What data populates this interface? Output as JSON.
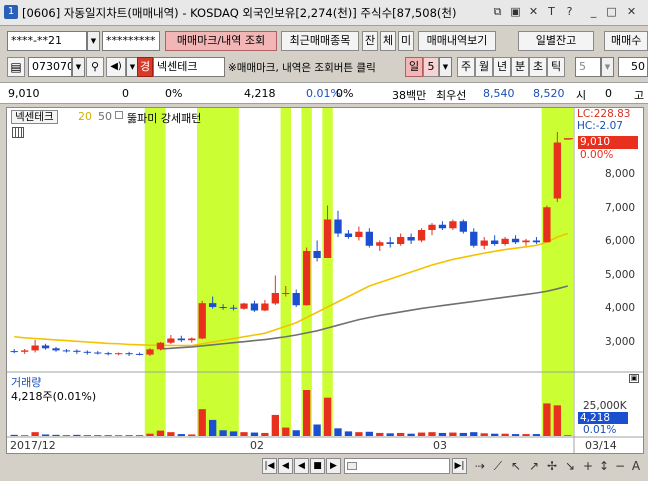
{
  "window": {
    "number_badge": "1",
    "title": "[0606] 자동일지차트(매매내역) - KOSDAQ 외국인보유[2,274(천)] 주식수[87,508(천)",
    "icons": [
      "restore-icon",
      "tile-icon",
      "pin-icon",
      "text-icon",
      "help-icon",
      "minimize-icon",
      "maximize-icon",
      "close-icon"
    ],
    "icon_glyphs": [
      "⧉",
      "▣",
      "✕",
      "T",
      "?",
      "_",
      "□",
      "✕"
    ]
  },
  "toolbar1": {
    "account": "****-**21",
    "password": "*********",
    "trade_mark_button": "매매마크/내역 조회",
    "recent_items_button": "최근매매종목",
    "balance_button": "잔",
    "filled_button": "체",
    "unfilled_button": "미",
    "trade_history_button": "매매내역보기",
    "daily_balance_button": "일별잔고",
    "trade_cut_button": "매매수"
  },
  "toolbar2": {
    "stock_code": "073070",
    "market_badge": "경",
    "stock_name": "넥센테크",
    "notice": "※매매마크, 내역은 조회버튼 클릭",
    "period_day": "일",
    "period_num": "5",
    "period_week": "주",
    "period_month": "월",
    "period_year": "년",
    "period_minute": "분",
    "period_second": "초",
    "period_tick": "틱",
    "tick_num": "5",
    "count_value": "50"
  },
  "quote": {
    "price": "9,010",
    "change": "0",
    "change_pct": "0%",
    "volume": "4,218",
    "vol_pct": "0.01%",
    "zero_pct": "0%",
    "trade_amount": "38백만",
    "best_bid_label": "최우선",
    "ask": "8,540",
    "bid": "8,520",
    "hoga_label": "시",
    "hoga_value": "0",
    "last_label": "고"
  },
  "chart": {
    "legend_name": "넥센테크",
    "ma_short": "20",
    "ma_long": "50",
    "pattern_label": "뚫파미 강세패턴",
    "lc_label": "LC:228.83",
    "hc_label": "HC:-2.07",
    "current_price_label": "9,010",
    "current_pct_label": "0.00%",
    "price_ticks": [
      "8,000",
      "7,000",
      "6,000",
      "5,000",
      "4,000",
      "3,000"
    ],
    "volume_title": "거래량",
    "volume_value": "4,218주(0.01%)",
    "volume_tick": "25,000K",
    "volume_current": "4,218",
    "volume_pct": "0.01%",
    "date_labels": [
      "2017/12",
      "02",
      "03"
    ],
    "last_date": "03/14",
    "colors": {
      "up": "#e8301f",
      "down": "#1a4fd0",
      "highlight": "#ccff33",
      "ma20": "#f5c200",
      "ma50": "#707070"
    }
  },
  "chart_data": {
    "type": "candlestick",
    "title": "",
    "price_range": [
      2400,
      9600
    ],
    "candles": [
      {
        "o": 2940,
        "h": 3000,
        "l": 2880,
        "c": 2920,
        "v": 3
      },
      {
        "o": 2920,
        "h": 3000,
        "l": 2860,
        "c": 2960,
        "v": 2
      },
      {
        "o": 2960,
        "h": 3260,
        "l": 2900,
        "c": 3100,
        "v": 10
      },
      {
        "o": 3100,
        "h": 3150,
        "l": 2980,
        "c": 3020,
        "v": 4
      },
      {
        "o": 3020,
        "h": 3060,
        "l": 2920,
        "c": 2960,
        "v": 3
      },
      {
        "o": 2960,
        "h": 3000,
        "l": 2900,
        "c": 2950,
        "v": 2
      },
      {
        "o": 2950,
        "h": 2990,
        "l": 2860,
        "c": 2920,
        "v": 3
      },
      {
        "o": 2920,
        "h": 2960,
        "l": 2840,
        "c": 2900,
        "v": 2
      },
      {
        "o": 2900,
        "h": 2940,
        "l": 2840,
        "c": 2880,
        "v": 2
      },
      {
        "o": 2880,
        "h": 2920,
        "l": 2820,
        "c": 2860,
        "v": 2
      },
      {
        "o": 2860,
        "h": 2900,
        "l": 2820,
        "c": 2880,
        "v": 2
      },
      {
        "o": 2880,
        "h": 2920,
        "l": 2800,
        "c": 2860,
        "v": 2
      },
      {
        "o": 2860,
        "h": 2900,
        "l": 2820,
        "c": 2840,
        "v": 2
      },
      {
        "o": 2840,
        "h": 3020,
        "l": 2800,
        "c": 2990,
        "v": 6
      },
      {
        "o": 2990,
        "h": 3200,
        "l": 2960,
        "c": 3180,
        "v": 14
      },
      {
        "o": 3180,
        "h": 3400,
        "l": 3140,
        "c": 3300,
        "v": 10
      },
      {
        "o": 3300,
        "h": 3380,
        "l": 3200,
        "c": 3250,
        "v": 5
      },
      {
        "o": 3250,
        "h": 3330,
        "l": 3180,
        "c": 3300,
        "v": 4
      },
      {
        "o": 3300,
        "h": 4380,
        "l": 3280,
        "c": 4310,
        "v": 70
      },
      {
        "o": 4310,
        "h": 4500,
        "l": 4150,
        "c": 4200,
        "v": 42
      },
      {
        "o": 4200,
        "h": 4280,
        "l": 4120,
        "c": 4180,
        "v": 15
      },
      {
        "o": 4180,
        "h": 4260,
        "l": 4100,
        "c": 4150,
        "v": 12
      },
      {
        "o": 4150,
        "h": 4320,
        "l": 4120,
        "c": 4300,
        "v": 10
      },
      {
        "o": 4300,
        "h": 4380,
        "l": 4060,
        "c": 4100,
        "v": 9
      },
      {
        "o": 4100,
        "h": 4400,
        "l": 4080,
        "c": 4300,
        "v": 8
      },
      {
        "o": 4300,
        "h": 5100,
        "l": 4260,
        "c": 4600,
        "v": 55
      },
      {
        "o": 4600,
        "h": 4800,
        "l": 4500,
        "c": 4600,
        "v": 22
      },
      {
        "o": 4600,
        "h": 4700,
        "l": 4200,
        "c": 4250,
        "v": 15
      },
      {
        "o": 4250,
        "h": 5900,
        "l": 4240,
        "c": 5800,
        "v": 120
      },
      {
        "o": 5800,
        "h": 6100,
        "l": 5500,
        "c": 5600,
        "v": 30
      },
      {
        "o": 5600,
        "h": 7100,
        "l": 5600,
        "c": 6700,
        "v": 100
      },
      {
        "o": 6700,
        "h": 6950,
        "l": 6200,
        "c": 6300,
        "v": 20
      },
      {
        "o": 6300,
        "h": 6400,
        "l": 6150,
        "c": 6200,
        "v": 12
      },
      {
        "o": 6200,
        "h": 6500,
        "l": 6100,
        "c": 6350,
        "v": 10
      },
      {
        "o": 6350,
        "h": 6450,
        "l": 5900,
        "c": 5950,
        "v": 11
      },
      {
        "o": 5950,
        "h": 6100,
        "l": 5800,
        "c": 6050,
        "v": 8
      },
      {
        "o": 6050,
        "h": 6200,
        "l": 5900,
        "c": 6000,
        "v": 7
      },
      {
        "o": 6000,
        "h": 6300,
        "l": 5950,
        "c": 6200,
        "v": 8
      },
      {
        "o": 6200,
        "h": 6300,
        "l": 6000,
        "c": 6100,
        "v": 6
      },
      {
        "o": 6100,
        "h": 6450,
        "l": 6050,
        "c": 6400,
        "v": 9
      },
      {
        "o": 6400,
        "h": 6600,
        "l": 6250,
        "c": 6550,
        "v": 10
      },
      {
        "o": 6550,
        "h": 6650,
        "l": 6400,
        "c": 6450,
        "v": 8
      },
      {
        "o": 6450,
        "h": 6700,
        "l": 6400,
        "c": 6650,
        "v": 9
      },
      {
        "o": 6650,
        "h": 6700,
        "l": 6300,
        "c": 6350,
        "v": 8
      },
      {
        "o": 6350,
        "h": 6450,
        "l": 5900,
        "c": 5950,
        "v": 10
      },
      {
        "o": 5950,
        "h": 6200,
        "l": 5850,
        "c": 6100,
        "v": 7
      },
      {
        "o": 6100,
        "h": 6250,
        "l": 5950,
        "c": 6000,
        "v": 6
      },
      {
        "o": 6000,
        "h": 6200,
        "l": 5950,
        "c": 6150,
        "v": 6
      },
      {
        "o": 6150,
        "h": 6250,
        "l": 6000,
        "c": 6050,
        "v": 5
      },
      {
        "o": 6050,
        "h": 6150,
        "l": 5950,
        "c": 6100,
        "v": 5
      },
      {
        "o": 6100,
        "h": 6200,
        "l": 6000,
        "c": 6050,
        "v": 5
      },
      {
        "o": 6050,
        "h": 7100,
        "l": 6050,
        "c": 7050,
        "v": 85
      },
      {
        "o": 7300,
        "h": 9200,
        "l": 7200,
        "c": 8900,
        "v": 80
      },
      {
        "o": 9010,
        "h": 9010,
        "l": 9010,
        "c": 9010,
        "v": 2
      }
    ],
    "highlight_ranges": [
      [
        13,
        14
      ],
      [
        18,
        21
      ],
      [
        26,
        26
      ],
      [
        28,
        28
      ],
      [
        30,
        30
      ],
      [
        51,
        53
      ]
    ],
    "ma20": [
      3350,
      3320,
      3300,
      3280,
      3260,
      3240,
      3220,
      3200,
      3180,
      3160,
      3150,
      3130,
      3120,
      3110,
      3110,
      3100,
      3100,
      3100,
      3150,
      3200,
      3250,
      3300,
      3350,
      3400,
      3450,
      3550,
      3650,
      3750,
      3900,
      4050,
      4200,
      4350,
      4500,
      4650,
      4800,
      4900,
      5000,
      5100,
      5200,
      5300,
      5400,
      5480,
      5560,
      5620,
      5680,
      5740,
      5790,
      5840,
      5880,
      5920,
      5960,
      6050,
      6200,
      6300
    ],
    "ma50": [
      null,
      null,
      null,
      null,
      null,
      null,
      null,
      null,
      null,
      null,
      null,
      null,
      null,
      null,
      3000,
      3020,
      3040,
      3060,
      3090,
      3120,
      3150,
      3180,
      3210,
      3240,
      3270,
      3310,
      3350,
      3400,
      3460,
      3520,
      3600,
      3680,
      3760,
      3840,
      3900,
      3960,
      4010,
      4060,
      4110,
      4160,
      4200,
      4240,
      4280,
      4320,
      4360,
      4400,
      4440,
      4480,
      4520,
      4560,
      4600,
      4650,
      4720,
      4800
    ]
  },
  "bottombar": {
    "nav_first": "|◀",
    "nav_prev": "◀",
    "nav_stop": "■",
    "nav_next": "▶",
    "nav_last": "▶|",
    "zoom_in": "+",
    "zoom_out": "−",
    "text_tool": "A"
  }
}
